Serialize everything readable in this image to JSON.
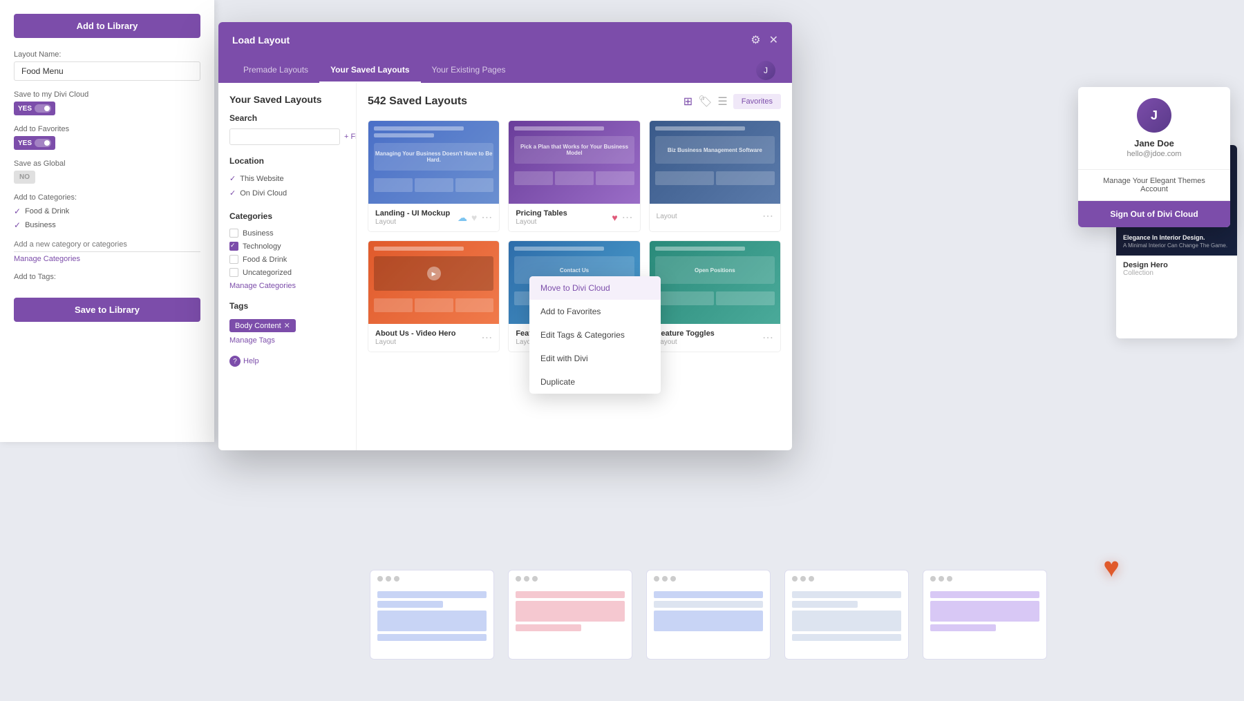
{
  "sidebar": {
    "title": "Add to Library",
    "layout_name_label": "Layout Name:",
    "layout_name_value": "Food Menu",
    "save_cloud_label": "Save to my Divi Cloud",
    "yes_label": "YES",
    "no_label": "NO",
    "add_favorites_label": "Add to Favorites",
    "save_global_label": "Save as Global",
    "add_categories_label": "Add to Categories:",
    "categories": [
      "Food & Drink",
      "Business"
    ],
    "add_category_placeholder": "Add a new category or categories",
    "manage_categories_link": "Manage Categories",
    "add_tags_label": "Add to Tags:",
    "save_btn": "Save to Library"
  },
  "modal": {
    "title": "Load Layout",
    "tabs": [
      {
        "label": "Premade Layouts",
        "active": false
      },
      {
        "label": "Your Saved Layouts",
        "active": true
      },
      {
        "label": "Your Existing Pages",
        "active": false
      }
    ],
    "filters": {
      "search_label": "Search",
      "filter_btn": "+ Filter",
      "location_label": "Location",
      "locations": [
        {
          "name": "This Website",
          "checked": true
        },
        {
          "name": "On Divi Cloud",
          "checked": true
        }
      ],
      "categories_label": "Categories",
      "categories": [
        {
          "name": "Business",
          "checked": false
        },
        {
          "name": "Technology",
          "checked": true
        },
        {
          "name": "Food & Drink",
          "checked": false
        },
        {
          "name": "Uncategorized",
          "checked": false
        }
      ],
      "manage_categories_link": "Manage Categories",
      "tags_label": "Tags",
      "tags": [
        {
          "name": "Body Content",
          "removable": true
        }
      ],
      "manage_tags_link": "Manage Tags",
      "help_label": "Help"
    },
    "content": {
      "count_label": "542 Saved Layouts",
      "favorites_btn": "Favorites",
      "layouts": [
        {
          "name": "Landing - UI Mockup",
          "type": "Layout",
          "thumb_style": "blue",
          "has_cloud": true,
          "has_heart": true,
          "heart_filled": false
        },
        {
          "name": "Pricing Tables",
          "type": "Layout",
          "thumb_style": "purple",
          "has_cloud": false,
          "has_heart": true,
          "heart_filled": true
        },
        {
          "name": "",
          "type": "Layout",
          "thumb_style": "gray",
          "has_cloud": false,
          "has_heart": false,
          "heart_filled": false
        },
        {
          "name": "About Us - Video Hero",
          "type": "Layout",
          "thumb_style": "orange",
          "has_cloud": false,
          "has_heart": false,
          "heart_filled": false
        },
        {
          "name": "Features Blurbs",
          "type": "Layout",
          "thumb_style": "blue2",
          "has_cloud": true,
          "has_heart": false,
          "heart_filled": false
        },
        {
          "name": "Feature Toggles",
          "type": "Layout",
          "thumb_style": "teal",
          "has_cloud": false,
          "has_heart": false,
          "heart_filled": false
        }
      ]
    }
  },
  "context_menu": {
    "items": [
      "Move to Divi Cloud",
      "Add to Favorites",
      "Edit Tags & Categories",
      "Edit with Divi",
      "Duplicate"
    ],
    "hovered_item": "Move to Divi Cloud"
  },
  "user_dropdown": {
    "name": "Jane Doe",
    "email": "hello@jdoe.com",
    "manage_account": "Manage Your Elegant Themes Account",
    "sign_out": "Sign Out of Divi Cloud"
  },
  "right_card": {
    "name": "Design Hero",
    "type": "Collection"
  },
  "bottom_thumbnails": [
    {
      "style": "blue-light"
    },
    {
      "style": "pink-light"
    },
    {
      "style": "blue-light2"
    },
    {
      "style": "purple-light"
    }
  ],
  "colors": {
    "primary": "#7c4daa",
    "heart_red": "#e05a7a",
    "cloud_blue": "#7cc4f0",
    "orange": "#e05a2b"
  }
}
